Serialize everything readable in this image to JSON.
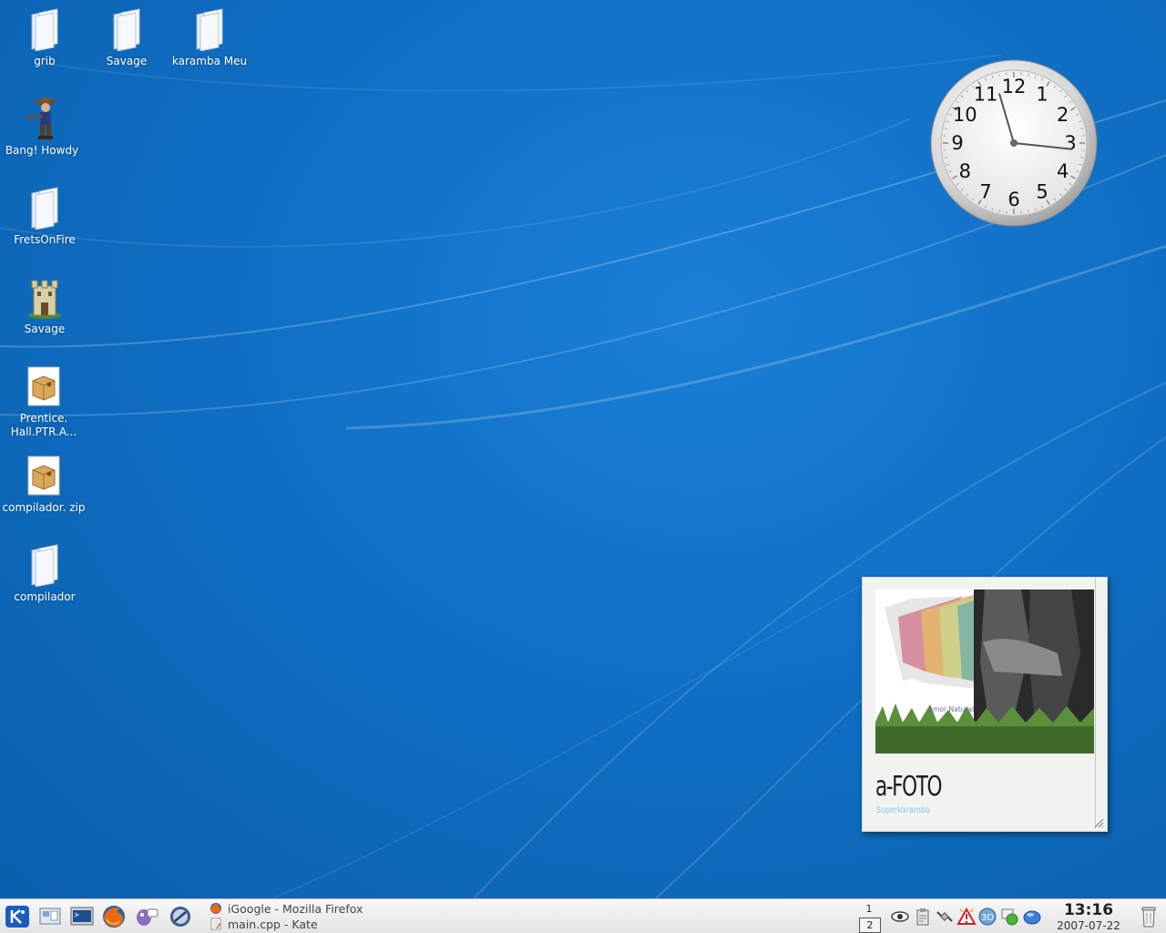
{
  "desktop": {
    "icons": [
      {
        "label": "grib",
        "type": "folder"
      },
      {
        "label": "Savage",
        "type": "folder"
      },
      {
        "label": "karamba Meu",
        "type": "folder"
      },
      {
        "label": "Bang! Howdy",
        "type": "game-cowboy"
      },
      {
        "label": "FretsOnFire",
        "type": "folder"
      },
      {
        "label": "Savage",
        "type": "game-castle"
      },
      {
        "label": "Prentice. Hall.PTR.A...",
        "type": "archive"
      },
      {
        "label": "compilador. zip",
        "type": "archive"
      },
      {
        "label": "compilador",
        "type": "folder"
      }
    ]
  },
  "analog_clock": {
    "numerals": [
      "12",
      "1",
      "2",
      "3",
      "4",
      "5",
      "6",
      "7",
      "8",
      "9",
      "10",
      "11"
    ],
    "time": "13:16"
  },
  "photo_widget": {
    "caption": "Amor Natural",
    "brand": "a-FOTO",
    "subtitle": "Superkaramba"
  },
  "taskbar": {
    "launchers": [
      "kde-menu-icon",
      "desktop-access-icon",
      "terminal-icon",
      "firefox-icon",
      "pidgin-icon",
      "network-app-icon"
    ],
    "tasks": [
      {
        "label": "iGoogle - Mozilla Firefox",
        "icon": "firefox-icon"
      },
      {
        "label": "main.cpp - Kate",
        "icon": "kate-icon"
      }
    ],
    "pager": [
      "1",
      "2"
    ],
    "pager_active": "2",
    "tray": [
      "eye-icon",
      "clipboard-icon",
      "network-cable-icon",
      "warning-icon",
      "display-icon",
      "green-status-icon",
      "globe-icon"
    ],
    "clock": {
      "time": "13:16",
      "date": "2007-07-22"
    }
  },
  "colors": {
    "desktop": "#0f6fc4",
    "taskbar": "#ececec"
  }
}
